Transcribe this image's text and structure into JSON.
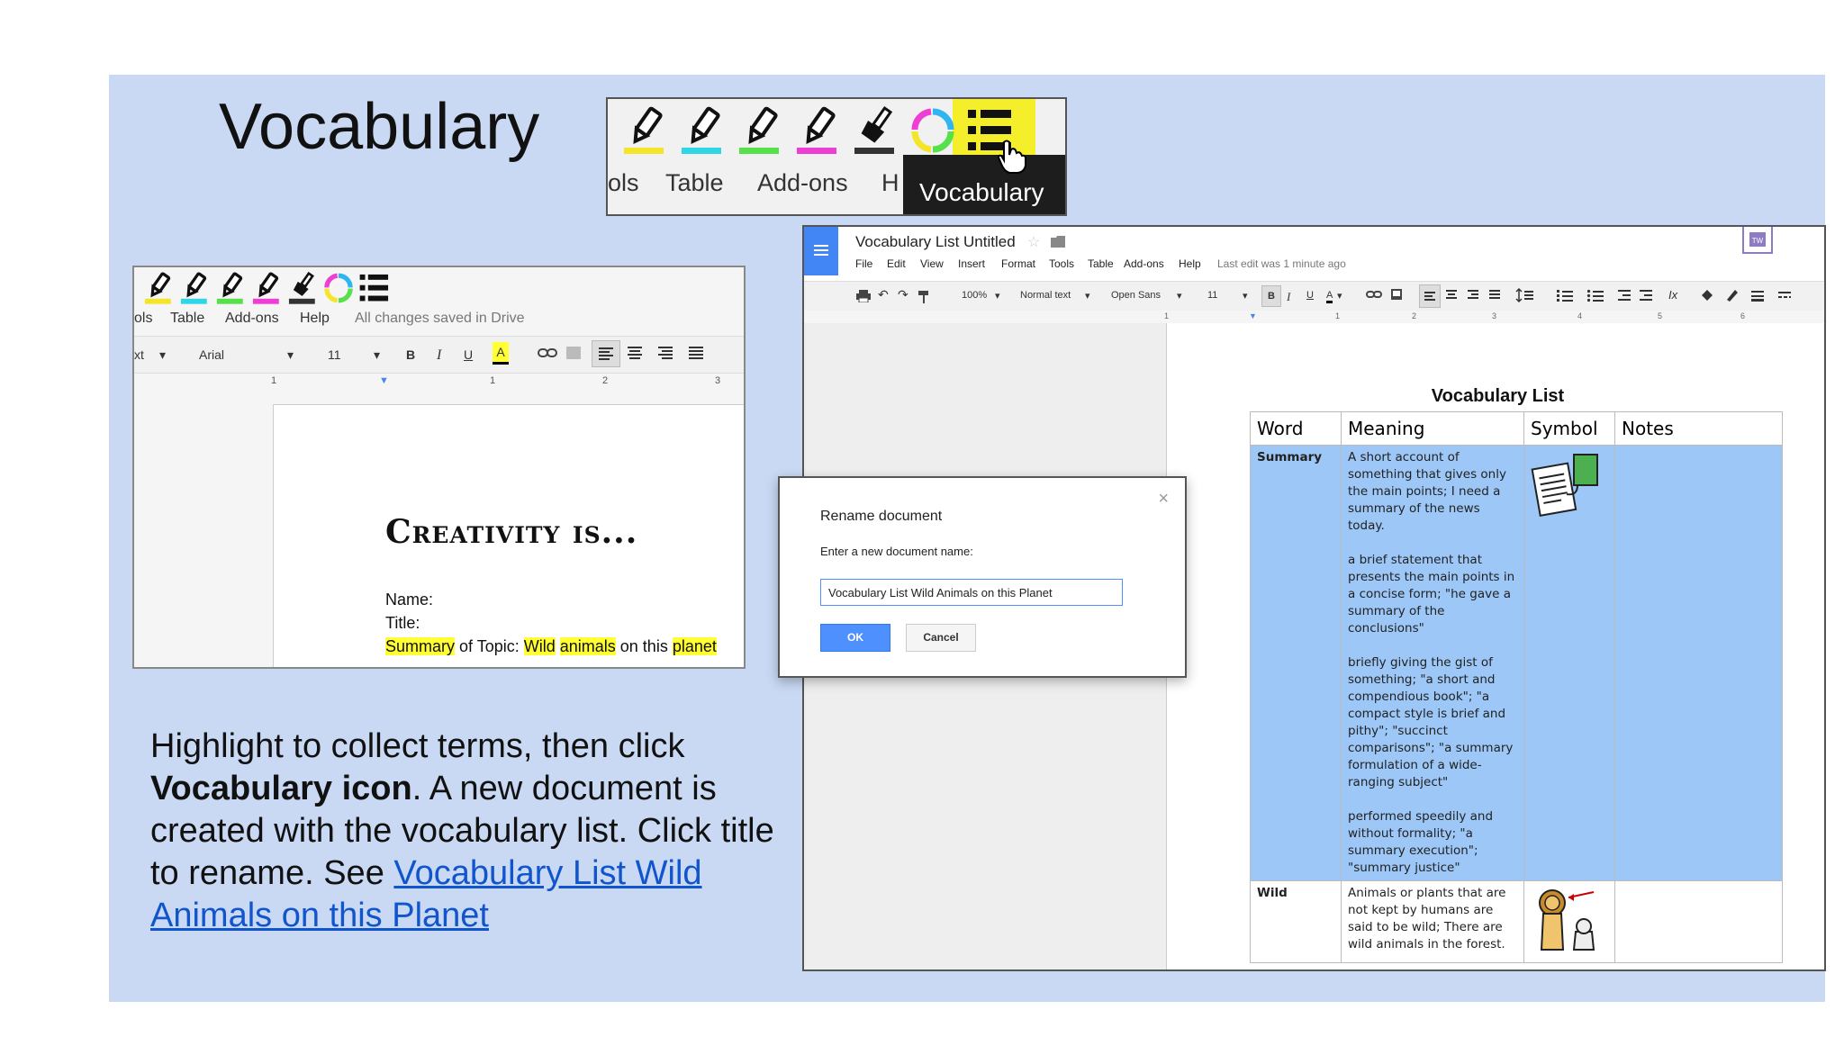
{
  "slide": {
    "title": "Vocabulary",
    "description": {
      "part1": "Highlight to collect terms, then click ",
      "bold": "Vocabulary icon",
      "part2": ". A new document is created with the vocabulary list. Click title to rename. See ",
      "link_text": "Vocabulary List Wild Animals on this Planet"
    }
  },
  "zoom_toolbar": {
    "menu": [
      "ols",
      "Table",
      "Add-ons",
      "H"
    ],
    "tooltip": "Vocabulary",
    "highlighter_colors": [
      "#f5e52a",
      "#2fd6e6",
      "#56e04a",
      "#ee3fd4",
      "#333333"
    ]
  },
  "left_doc": {
    "menu": [
      "ols",
      "Table",
      "Add-ons",
      "Help"
    ],
    "saved_status": "All changes saved in Drive",
    "style_value": "xt",
    "font": "Arial",
    "font_size": "11",
    "format_buttons": [
      "B",
      "I",
      "U",
      "A"
    ],
    "ruler": [
      "1",
      "1",
      "2",
      "3"
    ],
    "heading": "Creativity is...",
    "name_label": "Name:",
    "title_label": "Title:",
    "topic_line": {
      "w1": "Summary",
      "t1": " of Topic: ",
      "w2": "Wild",
      "t2": " ",
      "w3": "animals",
      "t3": " on this ",
      "w4": "planet"
    }
  },
  "gdoc": {
    "title": "Vocabulary List Untitled",
    "menu": [
      "File",
      "Edit",
      "View",
      "Insert",
      "Format",
      "Tools",
      "Table",
      "Add-ons",
      "Help"
    ],
    "last_edit": "Last edit was 1 minute ago",
    "zoom": "100%",
    "style": "Normal text",
    "font": "Open Sans",
    "font_size": "11",
    "format_buttons": [
      "B",
      "I",
      "U",
      "A"
    ],
    "ruler": [
      "1",
      "1",
      "2",
      "3",
      "4",
      "5",
      "6"
    ],
    "table_title": "Vocabulary List",
    "headers": [
      "Word",
      "Meaning",
      "Symbol",
      "Notes"
    ],
    "rows": [
      {
        "word": "Summary",
        "meanings": [
          "A short account of something that gives only the main points; I need a summary of the news today.",
          "a brief statement that presents the main points in a concise form; \"he gave a summary of the conclusions\"",
          "briefly giving the gist of something; \"a short and compendious book\"; \"a compact style is brief and pithy\"; \"succinct comparisons\"; \"a summary formulation of a wide-ranging subject\"",
          "performed speedily and without formality; \"a summary execution\"; \"summary justice\""
        ]
      },
      {
        "word": "Wild",
        "meanings": [
          "Animals or plants that are not kept by humans are said to be wild; There are wild animals in the forest."
        ]
      }
    ]
  },
  "dialog": {
    "title": "Rename document",
    "label": "Enter a new document name:",
    "value": "Vocabulary List Wild Animals on this Planet",
    "ok": "OK",
    "cancel": "Cancel",
    "close": "×"
  }
}
